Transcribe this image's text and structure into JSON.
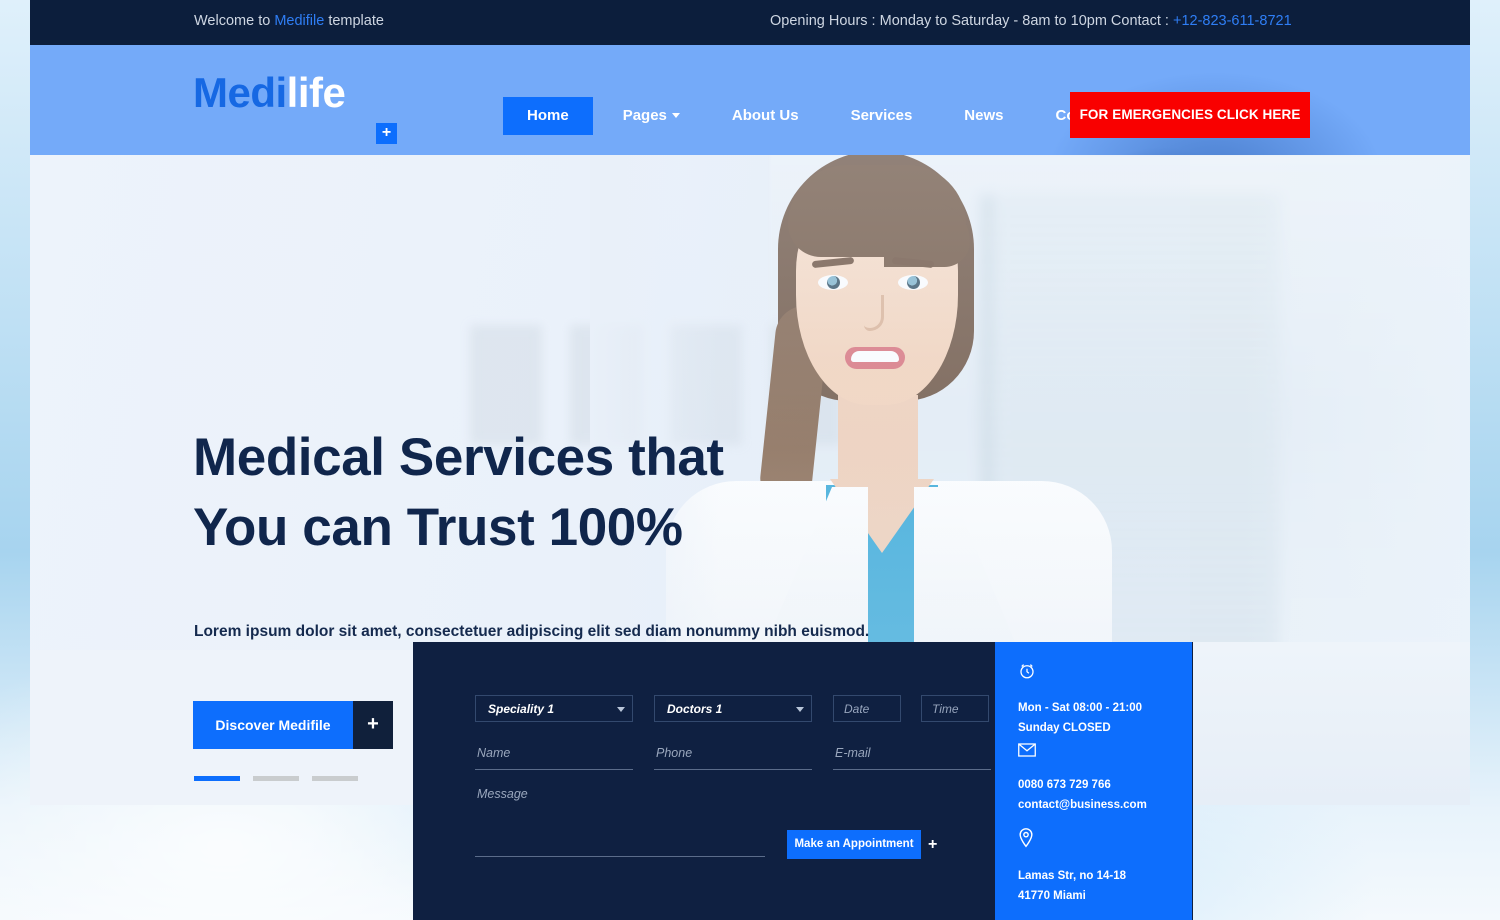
{
  "topbar": {
    "welcome_prefix": "Welcome to ",
    "brand": "Medifile",
    "welcome_suffix": " template",
    "hours": "Opening Hours : Monday to Saturday - 8am to 10pm Contact : ",
    "phone": "+12-823-611-8721"
  },
  "header": {
    "logo_first": "Medi",
    "logo_second": "life",
    "logo_plus": "+",
    "nav": [
      {
        "label": "Home",
        "active": true,
        "dropdown": false
      },
      {
        "label": "Pages",
        "active": false,
        "dropdown": true
      },
      {
        "label": "About Us",
        "active": false,
        "dropdown": false
      },
      {
        "label": "Services",
        "active": false,
        "dropdown": false
      },
      {
        "label": "News",
        "active": false,
        "dropdown": false
      },
      {
        "label": "Contact",
        "active": false,
        "dropdown": false
      }
    ],
    "emergency_label": "FOR EMERGENCIES CLICK HERE",
    "emergency_color": "#f90000",
    "nav_bg": "#74aaf9",
    "accent": "#0d6efd"
  },
  "hero": {
    "title_line1": "Medical Services that",
    "title_line2": "You can Trust 100%",
    "subtitle": "Lorem ipsum dolor sit amet, consectetuer adipiscing elit sed diam nonummy nibh euismod.",
    "cta_label": "Discover Medifile",
    "cta_plus": "+",
    "slider_dots": 3,
    "slider_active_index": 0,
    "title_color": "#10264c"
  },
  "appointment": {
    "speciality": {
      "value": "Speciality 1",
      "options": [
        "Speciality 1"
      ]
    },
    "doctors": {
      "value": "Doctors 1",
      "options": [
        "Doctors 1"
      ]
    },
    "date_placeholder": "Date",
    "time_placeholder": "Time",
    "name_placeholder": "Name",
    "phone_placeholder": "Phone",
    "email_placeholder": "E-mail",
    "message_placeholder": "Message",
    "submit_label": "Make an Appointment",
    "submit_plus": "+",
    "panel_color": "#0f2041"
  },
  "info": {
    "panel_color": "#0d6efd",
    "hours_icon": "clock-icon",
    "hours_line1": "Mon - Sat 08:00 - 21:00",
    "hours_line2": "Sunday CLOSED",
    "mail_icon": "envelope-icon",
    "contact_line1": "0080 673 729 766",
    "contact_line2": "contact@business.com",
    "location_icon": "map-pin-icon",
    "address_line1": "Lamas Str, no 14-18",
    "address_line2": "41770 Miami"
  }
}
